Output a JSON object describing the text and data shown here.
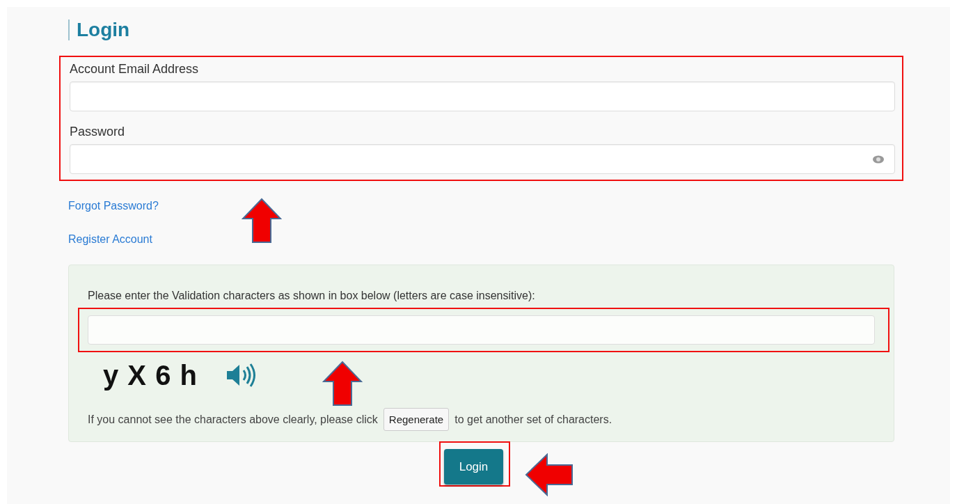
{
  "title": "Login",
  "fields": [
    {
      "label": "Account Email Address",
      "kind": "text"
    },
    {
      "label": "Password",
      "kind": "password"
    }
  ],
  "links": [
    "Forgot Password?",
    "Register Account"
  ],
  "captcha": {
    "prompt": "Please enter the Validation characters as shown in box below (letters are case insensitive):",
    "code": "y X 6 h",
    "help_before": "If you cannot see the characters above clearly, please click",
    "regenerate": "Regenerate",
    "help_after": "to get another set of characters."
  },
  "submit": "Login"
}
